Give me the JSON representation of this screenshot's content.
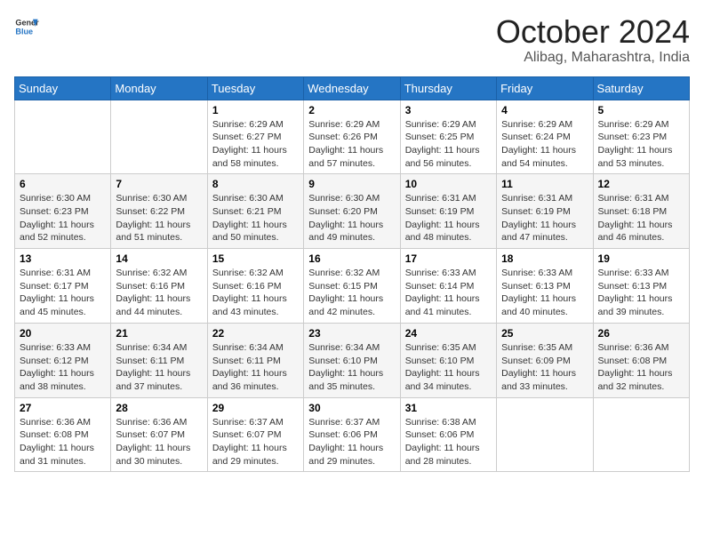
{
  "header": {
    "logo_line1": "General",
    "logo_line2": "Blue",
    "month": "October 2024",
    "location": "Alibag, Maharashtra, India"
  },
  "weekdays": [
    "Sunday",
    "Monday",
    "Tuesday",
    "Wednesday",
    "Thursday",
    "Friday",
    "Saturday"
  ],
  "weeks": [
    [
      {
        "day": "",
        "info": ""
      },
      {
        "day": "",
        "info": ""
      },
      {
        "day": "1",
        "info": "Sunrise: 6:29 AM\nSunset: 6:27 PM\nDaylight: 11 hours and 58 minutes."
      },
      {
        "day": "2",
        "info": "Sunrise: 6:29 AM\nSunset: 6:26 PM\nDaylight: 11 hours and 57 minutes."
      },
      {
        "day": "3",
        "info": "Sunrise: 6:29 AM\nSunset: 6:25 PM\nDaylight: 11 hours and 56 minutes."
      },
      {
        "day": "4",
        "info": "Sunrise: 6:29 AM\nSunset: 6:24 PM\nDaylight: 11 hours and 54 minutes."
      },
      {
        "day": "5",
        "info": "Sunrise: 6:29 AM\nSunset: 6:23 PM\nDaylight: 11 hours and 53 minutes."
      }
    ],
    [
      {
        "day": "6",
        "info": "Sunrise: 6:30 AM\nSunset: 6:23 PM\nDaylight: 11 hours and 52 minutes."
      },
      {
        "day": "7",
        "info": "Sunrise: 6:30 AM\nSunset: 6:22 PM\nDaylight: 11 hours and 51 minutes."
      },
      {
        "day": "8",
        "info": "Sunrise: 6:30 AM\nSunset: 6:21 PM\nDaylight: 11 hours and 50 minutes."
      },
      {
        "day": "9",
        "info": "Sunrise: 6:30 AM\nSunset: 6:20 PM\nDaylight: 11 hours and 49 minutes."
      },
      {
        "day": "10",
        "info": "Sunrise: 6:31 AM\nSunset: 6:19 PM\nDaylight: 11 hours and 48 minutes."
      },
      {
        "day": "11",
        "info": "Sunrise: 6:31 AM\nSunset: 6:19 PM\nDaylight: 11 hours and 47 minutes."
      },
      {
        "day": "12",
        "info": "Sunrise: 6:31 AM\nSunset: 6:18 PM\nDaylight: 11 hours and 46 minutes."
      }
    ],
    [
      {
        "day": "13",
        "info": "Sunrise: 6:31 AM\nSunset: 6:17 PM\nDaylight: 11 hours and 45 minutes."
      },
      {
        "day": "14",
        "info": "Sunrise: 6:32 AM\nSunset: 6:16 PM\nDaylight: 11 hours and 44 minutes."
      },
      {
        "day": "15",
        "info": "Sunrise: 6:32 AM\nSunset: 6:16 PM\nDaylight: 11 hours and 43 minutes."
      },
      {
        "day": "16",
        "info": "Sunrise: 6:32 AM\nSunset: 6:15 PM\nDaylight: 11 hours and 42 minutes."
      },
      {
        "day": "17",
        "info": "Sunrise: 6:33 AM\nSunset: 6:14 PM\nDaylight: 11 hours and 41 minutes."
      },
      {
        "day": "18",
        "info": "Sunrise: 6:33 AM\nSunset: 6:13 PM\nDaylight: 11 hours and 40 minutes."
      },
      {
        "day": "19",
        "info": "Sunrise: 6:33 AM\nSunset: 6:13 PM\nDaylight: 11 hours and 39 minutes."
      }
    ],
    [
      {
        "day": "20",
        "info": "Sunrise: 6:33 AM\nSunset: 6:12 PM\nDaylight: 11 hours and 38 minutes."
      },
      {
        "day": "21",
        "info": "Sunrise: 6:34 AM\nSunset: 6:11 PM\nDaylight: 11 hours and 37 minutes."
      },
      {
        "day": "22",
        "info": "Sunrise: 6:34 AM\nSunset: 6:11 PM\nDaylight: 11 hours and 36 minutes."
      },
      {
        "day": "23",
        "info": "Sunrise: 6:34 AM\nSunset: 6:10 PM\nDaylight: 11 hours and 35 minutes."
      },
      {
        "day": "24",
        "info": "Sunrise: 6:35 AM\nSunset: 6:10 PM\nDaylight: 11 hours and 34 minutes."
      },
      {
        "day": "25",
        "info": "Sunrise: 6:35 AM\nSunset: 6:09 PM\nDaylight: 11 hours and 33 minutes."
      },
      {
        "day": "26",
        "info": "Sunrise: 6:36 AM\nSunset: 6:08 PM\nDaylight: 11 hours and 32 minutes."
      }
    ],
    [
      {
        "day": "27",
        "info": "Sunrise: 6:36 AM\nSunset: 6:08 PM\nDaylight: 11 hours and 31 minutes."
      },
      {
        "day": "28",
        "info": "Sunrise: 6:36 AM\nSunset: 6:07 PM\nDaylight: 11 hours and 30 minutes."
      },
      {
        "day": "29",
        "info": "Sunrise: 6:37 AM\nSunset: 6:07 PM\nDaylight: 11 hours and 29 minutes."
      },
      {
        "day": "30",
        "info": "Sunrise: 6:37 AM\nSunset: 6:06 PM\nDaylight: 11 hours and 29 minutes."
      },
      {
        "day": "31",
        "info": "Sunrise: 6:38 AM\nSunset: 6:06 PM\nDaylight: 11 hours and 28 minutes."
      },
      {
        "day": "",
        "info": ""
      },
      {
        "day": "",
        "info": ""
      }
    ]
  ]
}
